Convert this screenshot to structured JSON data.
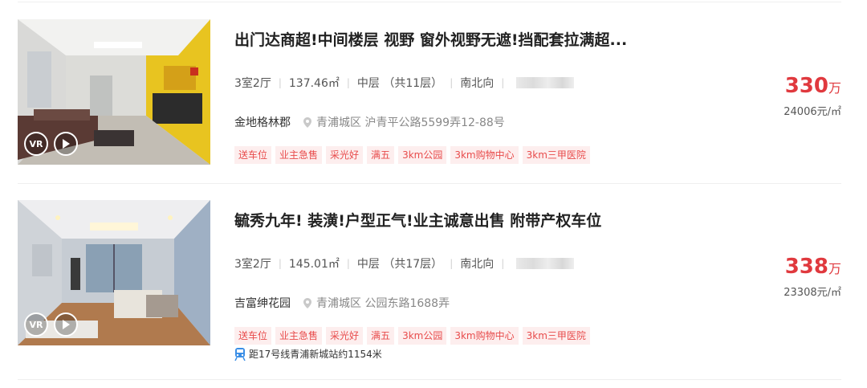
{
  "colors": {
    "price_red": "#e0393e",
    "tag_text": "#e84c4c",
    "tag_bg": "#fdeeee",
    "metro_blue": "#3a8ee6"
  },
  "listings": [
    {
      "title": "出门达商超!中间楼层 视野 窗外视野无遮!挡配套拉满超...",
      "layout": "3室2厅",
      "area": "137.46㎡",
      "floor": "中层 （共11层）",
      "orientation": "南北向",
      "community": "金地格林郡",
      "address": "青浦城区 沪青平公路5599弄12-88号",
      "tags": [
        "送车位",
        "业主急售",
        "采光好",
        "满五",
        "3km公园",
        "3km购物中心",
        "3km三甲医院"
      ],
      "price": "330",
      "price_unit": "万",
      "unit_price": "24006元/㎡",
      "vr_label": "VR",
      "icons": [
        "location-pin-icon",
        "play-icon"
      ]
    },
    {
      "title": "毓秀九年! 装潢!户型正气!业主诚意出售 附带产权车位",
      "layout": "3室2厅",
      "area": "145.01㎡",
      "floor": "中层 （共17层）",
      "orientation": "南北向",
      "community": "吉富绅花园",
      "address": "青浦城区 公园东路1688弄",
      "tags": [
        "送车位",
        "业主急售",
        "采光好",
        "满五",
        "3km公园",
        "3km购物中心",
        "3km三甲医院"
      ],
      "metro": "距17号线青浦新城站约1154米",
      "price": "338",
      "price_unit": "万",
      "unit_price": "23308元/㎡",
      "vr_label": "VR",
      "icons": [
        "location-pin-icon",
        "play-icon",
        "metro-icon"
      ]
    }
  ]
}
